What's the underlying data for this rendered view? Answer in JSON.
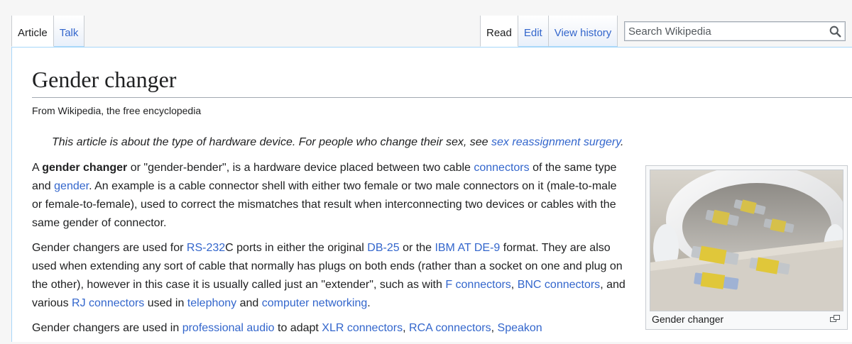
{
  "tabs_left": [
    {
      "label": "Article",
      "selected": true
    },
    {
      "label": "Talk",
      "selected": false
    }
  ],
  "tabs_right": [
    {
      "label": "Read",
      "selected": true
    },
    {
      "label": "Edit",
      "selected": false
    },
    {
      "label": "View history",
      "selected": false
    }
  ],
  "search": {
    "placeholder": "Search Wikipedia",
    "icon": "search-icon"
  },
  "page": {
    "title": "Gender changer",
    "tagline": "From Wikipedia, the free encyclopedia",
    "hatnote": {
      "text": "This article is about the type of hardware device. For people who change their sex, see ",
      "link": "sex reassignment surgery",
      "end": "."
    },
    "p1": {
      "t1": "A ",
      "bold": "gender changer",
      "t2": " or \"gender-bender\", is a hardware device placed between two cable ",
      "link1": "connectors",
      "t3": " of the same type and ",
      "link2": "gender",
      "t4": ". An example is a cable connector shell with either two female or two male connectors on it (male-to-male or female-to-female), used to correct the mismatches that result when interconnecting two devices or cables with the same gender of connector."
    },
    "p2": {
      "t1": "Gender changers are used for ",
      "link1": "RS-232",
      "t2": "C ports in either the original ",
      "link2": "DB-25",
      "t3": " or the ",
      "link3": "IBM AT DE-9",
      "t4": " format. They are also used when extending any sort of cable that normally has plugs on both ends (rather than a socket on one and plug on the other), however in this case it is usually called just an \"extender\", such as with ",
      "link4": "F connectors",
      "t5": ", ",
      "link5": "BNC connectors",
      "t6": ", and various ",
      "link6": "RJ connectors",
      "t7": " used in ",
      "link7": "telephony",
      "t8": " and ",
      "link8": "computer networking",
      "t9": "."
    },
    "p3": {
      "t1": "Gender changers are used in ",
      "link1": "professional audio",
      "t2": " to adapt ",
      "link2": "XLR connectors",
      "t3": ", ",
      "link3": "RCA connectors",
      "t4": ", ",
      "link4": "Speakon"
    }
  },
  "thumbnail": {
    "caption": "Gender changer",
    "enlarge_icon": "enlarge-icon"
  },
  "colors": {
    "link": "#3366cc",
    "text": "#202122",
    "tab_border": "#a7d7f9"
  }
}
